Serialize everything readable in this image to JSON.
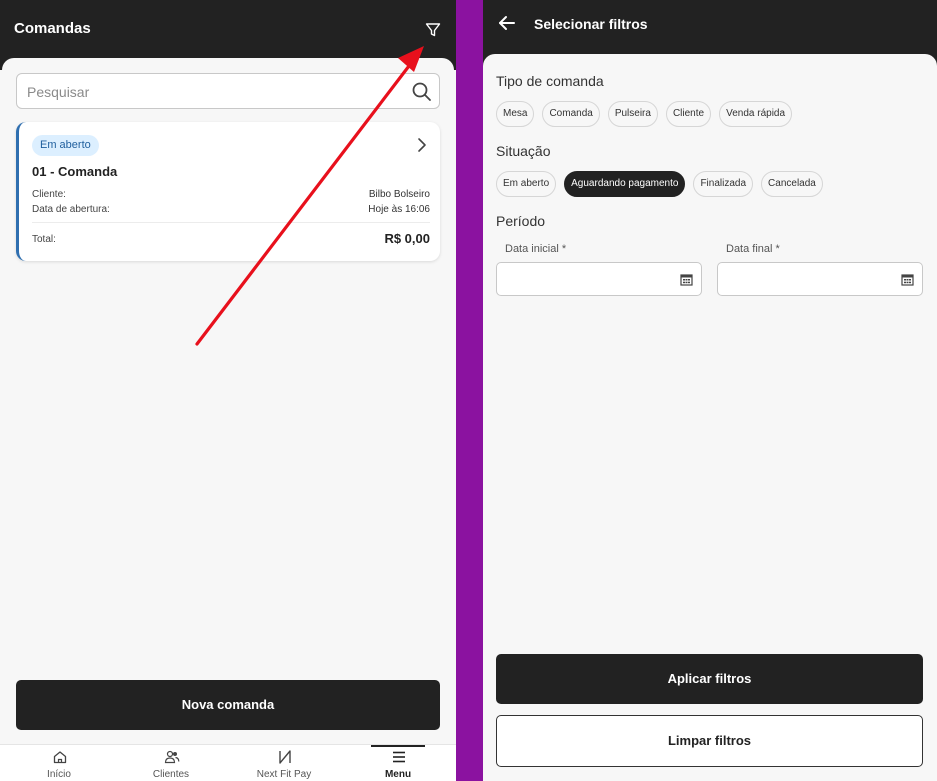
{
  "left": {
    "header": {
      "title": "Comandas",
      "filter_icon": "filter-icon"
    },
    "search": {
      "placeholder": "Pesquisar",
      "icon": "search-icon"
    },
    "order_card": {
      "status": "Em aberto",
      "title": "01 - Comanda",
      "client_label": "Cliente:",
      "client_value": "Bilbo Bolseiro",
      "opened_label": "Data de abertura:",
      "opened_value": "Hoje às 16:06",
      "total_label": "Total:",
      "total_value": "R$ 0,00"
    },
    "new_order_button": "Nova comanda",
    "bottom_nav": [
      {
        "label": "Início",
        "icon": "home-icon"
      },
      {
        "label": "Clientes",
        "icon": "users-icon"
      },
      {
        "label": "Next Fit Pay",
        "icon": "nextfit-logo-icon"
      },
      {
        "label": "Menu",
        "icon": "menu-icon",
        "active": true
      }
    ],
    "annotation": {
      "color": "#e8101c"
    }
  },
  "right": {
    "header": {
      "title": "Selecionar filtros",
      "back_icon": "arrow-left-icon"
    },
    "type_section": {
      "title": "Tipo de comanda",
      "chips": [
        "Mesa",
        "Comanda",
        "Pulseira",
        "Cliente",
        "Venda rápida"
      ]
    },
    "status_section": {
      "title": "Situação",
      "chips": [
        "Em aberto",
        "Aguardando pagamento",
        "Finalizada",
        "Cancelada"
      ],
      "selected": "Aguardando pagamento"
    },
    "period_section": {
      "title": "Período",
      "start_label": "Data inicial *",
      "end_label": "Data final *",
      "start_value": "",
      "end_value": ""
    },
    "apply_button": "Aplicar filtros",
    "clear_button": "Limpar filtros"
  },
  "colors": {
    "dark": "#222222",
    "background": "#f7f7f7",
    "divider": "#8b12a0",
    "badge_bg": "#dcefff",
    "badge_text": "#1f5f9e",
    "card_accent": "#2f6fb0"
  }
}
